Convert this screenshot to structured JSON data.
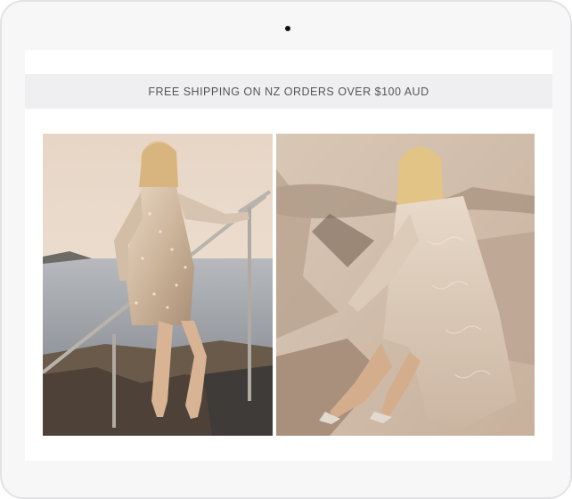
{
  "promo_banner": {
    "text": "FREE SHIPPING ON NZ ORDERS OVER $100 AUD"
  },
  "gallery": {
    "images": [
      {
        "name": "model-sequin-dress-seaside"
      },
      {
        "name": "model-lace-gown-rocks"
      }
    ]
  },
  "colors": {
    "banner_bg": "#efeff1",
    "banner_text": "#555555",
    "device_frame": "#f7f7f8"
  }
}
